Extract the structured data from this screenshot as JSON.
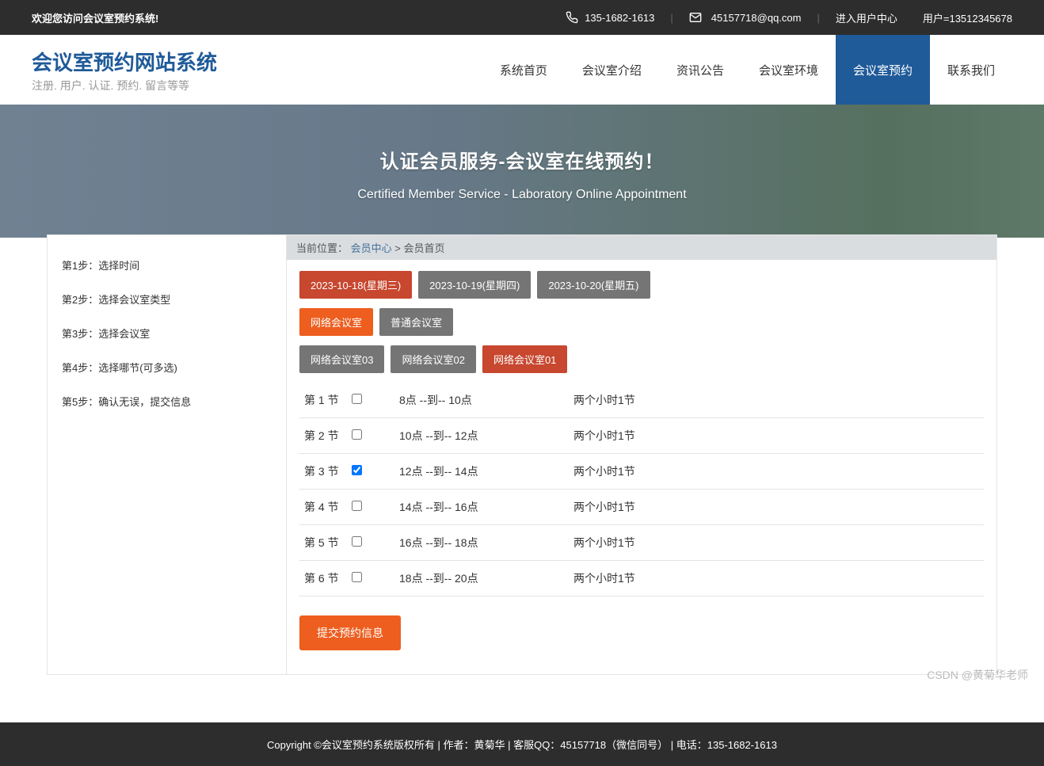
{
  "topbar": {
    "welcome": "欢迎您访问会议室预约系统!",
    "phone": "135-1682-1613",
    "email": "45157718@qq.com",
    "user_center": "进入用户中心",
    "user_label": "用户=13512345678"
  },
  "logo": {
    "title": "会议室预约网站系统",
    "subtitle": "注册. 用户. 认证. 预约. 留言等等"
  },
  "nav": {
    "items": [
      {
        "label": "系统首页",
        "active": false
      },
      {
        "label": "会议室介绍",
        "active": false
      },
      {
        "label": "资讯公告",
        "active": false
      },
      {
        "label": "会议室环境",
        "active": false
      },
      {
        "label": "会议室预约",
        "active": true
      },
      {
        "label": "联系我们",
        "active": false
      }
    ]
  },
  "banner": {
    "title_cn": "认证会员服务-会议室在线预约！",
    "title_en": "Certified Member Service - Laboratory Online Appointment"
  },
  "sidebar": {
    "steps": [
      "第1步：选择时间",
      "第2步：选择会议室类型",
      "第3步：选择会议室",
      "第4步：选择哪节(可多选)",
      "第5步：确认无误，提交信息"
    ]
  },
  "breadcrumb": {
    "prefix": "当前位置：",
    "link1": "会员中心",
    "sep": " > ",
    "current": "会员首页"
  },
  "dates": [
    {
      "label": "2023-10-18(星期三)",
      "style": "red"
    },
    {
      "label": "2023-10-19(星期四)",
      "style": "gray"
    },
    {
      "label": "2023-10-20(星期五)",
      "style": "gray"
    }
  ],
  "room_types": [
    {
      "label": "网络会议室",
      "style": "orange"
    },
    {
      "label": "普通会议室",
      "style": "gray"
    }
  ],
  "rooms": [
    {
      "label": "网络会议室03",
      "style": "gray"
    },
    {
      "label": "网络会议室02",
      "style": "gray"
    },
    {
      "label": "网络会议室01",
      "style": "red"
    }
  ],
  "slots": [
    {
      "no": "第 1 节",
      "checked": false,
      "time": "8点 --到-- 10点",
      "note": "两个小时1节"
    },
    {
      "no": "第 2 节",
      "checked": false,
      "time": "10点 --到-- 12点",
      "note": "两个小时1节"
    },
    {
      "no": "第 3 节",
      "checked": true,
      "time": "12点 --到-- 14点",
      "note": "两个小时1节"
    },
    {
      "no": "第 4 节",
      "checked": false,
      "time": "14点 --到-- 16点",
      "note": "两个小时1节"
    },
    {
      "no": "第 5 节",
      "checked": false,
      "time": "16点 --到-- 18点",
      "note": "两个小时1节"
    },
    {
      "no": "第 6 节",
      "checked": false,
      "time": "18点 --到-- 20点",
      "note": "两个小时1节"
    }
  ],
  "submit_label": "提交预约信息",
  "footer": {
    "text": "Copyright ©会议室预约系统版权所有 | 作者：黄菊华 | 客服QQ：45157718（微信同号） | 电话：135-1682-1613"
  },
  "watermark": "CSDN @黄菊华老师"
}
